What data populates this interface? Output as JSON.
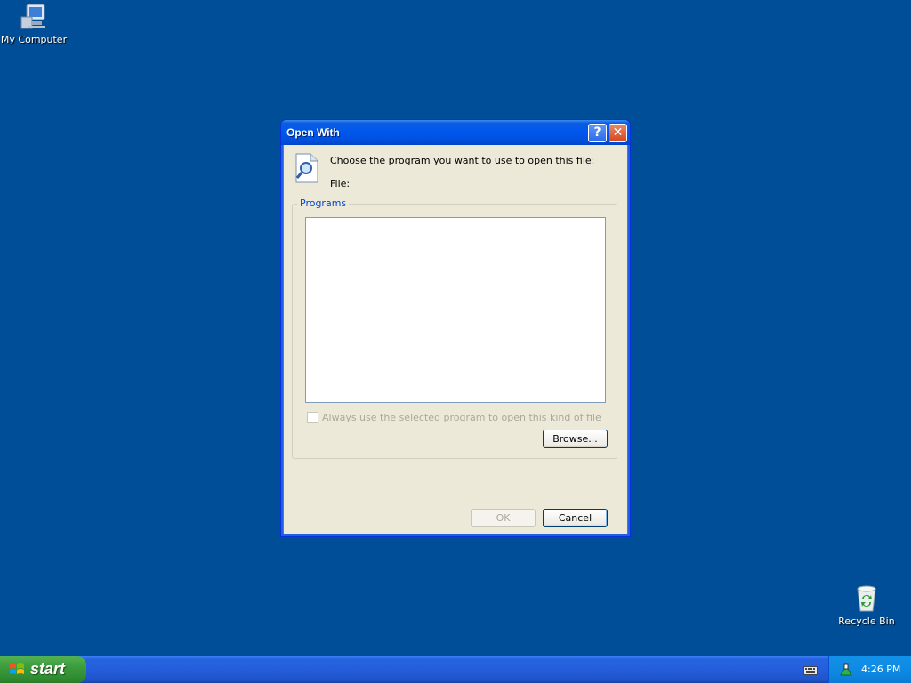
{
  "desktop": {
    "icons": [
      {
        "label": "My Computer",
        "icon": "computer-icon"
      },
      {
        "label": "Recycle Bin",
        "icon": "recycle-bin-icon"
      }
    ]
  },
  "dialog": {
    "title": "Open With",
    "help_glyph": "?",
    "close_glyph": "✕",
    "prompt": "Choose the program you want to use to open this file:",
    "file_label": "File:",
    "programs_group": "Programs",
    "programs_list": [],
    "always_use_label": "Always use the selected program to open this kind of file",
    "always_use_checked": false,
    "browse_label": "Browse...",
    "ok_label": "OK",
    "cancel_label": "Cancel"
  },
  "taskbar": {
    "start_label": "start",
    "clock": "4:26 PM"
  },
  "colors": {
    "desktop": "#004e98",
    "titlebar": "#0058ee",
    "accent_group_label": "#0046d5"
  }
}
